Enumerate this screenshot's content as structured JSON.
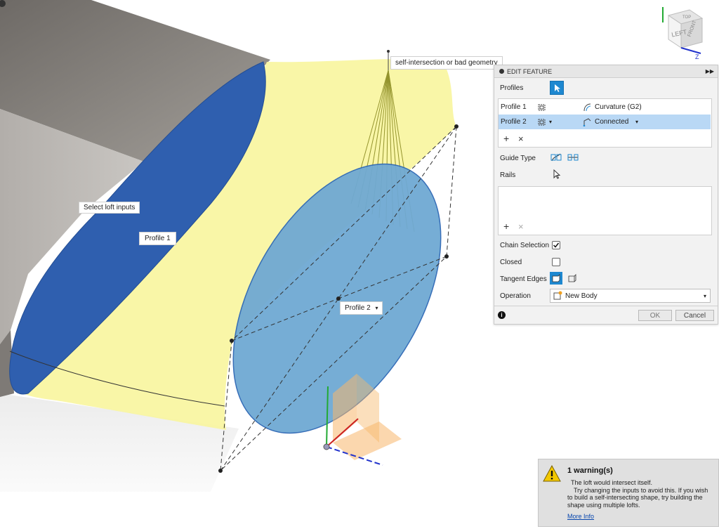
{
  "viewport": {
    "callout_select": "Select loft inputs",
    "callout_profile1": "Profile 1",
    "callout_profile2": "Profile 2",
    "callout_intersection": "self-intersection or bad geometry",
    "viewcube_left": "LEFT",
    "viewcube_front": "FRONT",
    "viewcube_top": "TOP",
    "axis_z": "Z",
    "axis_y": "Y"
  },
  "panel": {
    "title": "EDIT FEATURE",
    "profiles_label": "Profiles",
    "profile_rows": [
      {
        "name": "Profile 1",
        "condition": "Curvature (G2)",
        "selected": false
      },
      {
        "name": "Profile 2",
        "condition": "Connected",
        "selected": true
      }
    ],
    "add_symbol": "+",
    "remove_symbol": "×",
    "guide_type_label": "Guide Type",
    "rails_label": "Rails",
    "chain_selection_label": "Chain Selection",
    "chain_selection_checked": true,
    "closed_label": "Closed",
    "closed_checked": false,
    "tangent_edges_label": "Tangent Edges",
    "operation_label": "Operation",
    "operation_value": "New Body",
    "ok_label": "OK",
    "cancel_label": "Cancel",
    "info_symbol": "i"
  },
  "warning": {
    "title": "1 warning(s)",
    "line1": "The loft would intersect itself.",
    "line2": "Try changing the inputs to avoid this. If you wish to build a self-intersecting shape, try building the shape using multiple lofts.",
    "more_info": "More Info"
  },
  "colors": {
    "accent_blue": "#1e88d0",
    "profile1_blue": "#2f5faf",
    "profile2_blue": "#6fa9d3",
    "loft_yellow": "#faf7a3",
    "body_gray": "#8a8580",
    "selected_row": "#b9d8f5"
  }
}
